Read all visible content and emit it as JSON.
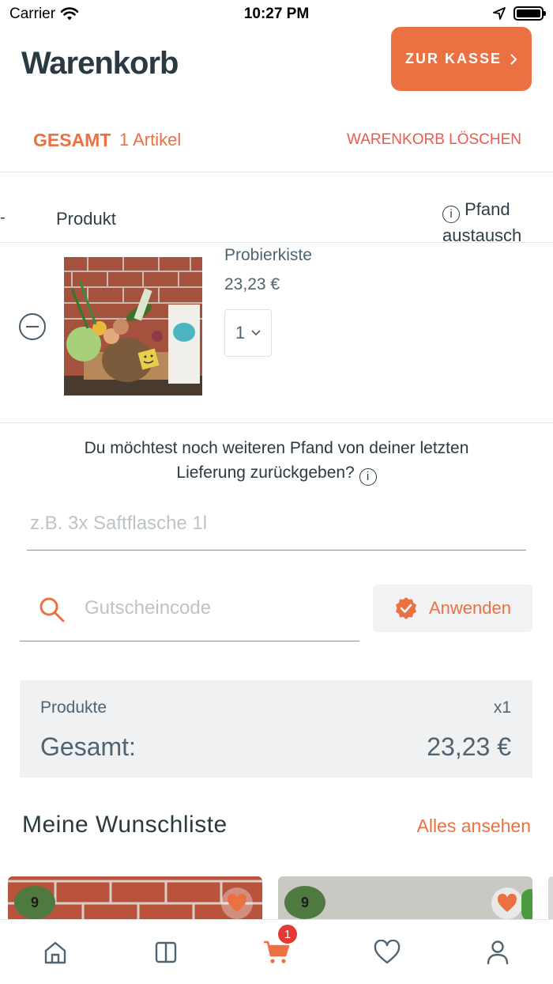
{
  "status_bar": {
    "carrier": "Carrier",
    "time": "10:27 PM"
  },
  "header": {
    "title": "Warenkorb",
    "checkout_label": "ZUR KASSE"
  },
  "summary": {
    "total_label": "GESAMT",
    "item_count": "1 Artikel",
    "clear_label": "WARENKORB LÖSCHEN"
  },
  "table_header": {
    "dash": "-",
    "product": "Produkt",
    "deposit_line1": "Pfand",
    "deposit_line2": "austausch"
  },
  "cart_items": [
    {
      "name": "Probierkiste",
      "price": "23,23 €",
      "quantity": "1"
    }
  ],
  "deposit_return": {
    "question_line1": "Du möchtest noch weiteren Pfand von deiner letzten",
    "question_line2": "Lieferung zurückgeben?",
    "placeholder": "z.B. 3x Saftflasche 1l"
  },
  "voucher": {
    "placeholder": "Gutscheincode",
    "apply_label": "Anwenden"
  },
  "totals": {
    "products_label": "Produkte",
    "products_qty": "x1",
    "total_label": "Gesamt:",
    "total_value": "23,23 €"
  },
  "wishlist": {
    "title": "Meine Wunschliste",
    "see_all": "Alles ansehen",
    "cards": [
      {
        "badge": "9"
      },
      {
        "badge": "9"
      }
    ]
  },
  "tab_bar": {
    "items": [
      {
        "icon": "home-icon"
      },
      {
        "icon": "catalog-icon"
      },
      {
        "icon": "cart-icon",
        "badge": "1"
      },
      {
        "icon": "heart-icon"
      },
      {
        "icon": "profile-icon"
      }
    ]
  },
  "colors": {
    "accent": "#ec7142",
    "danger": "#ea5b4e",
    "text": "#2f3e46",
    "badge": "#e53935"
  }
}
